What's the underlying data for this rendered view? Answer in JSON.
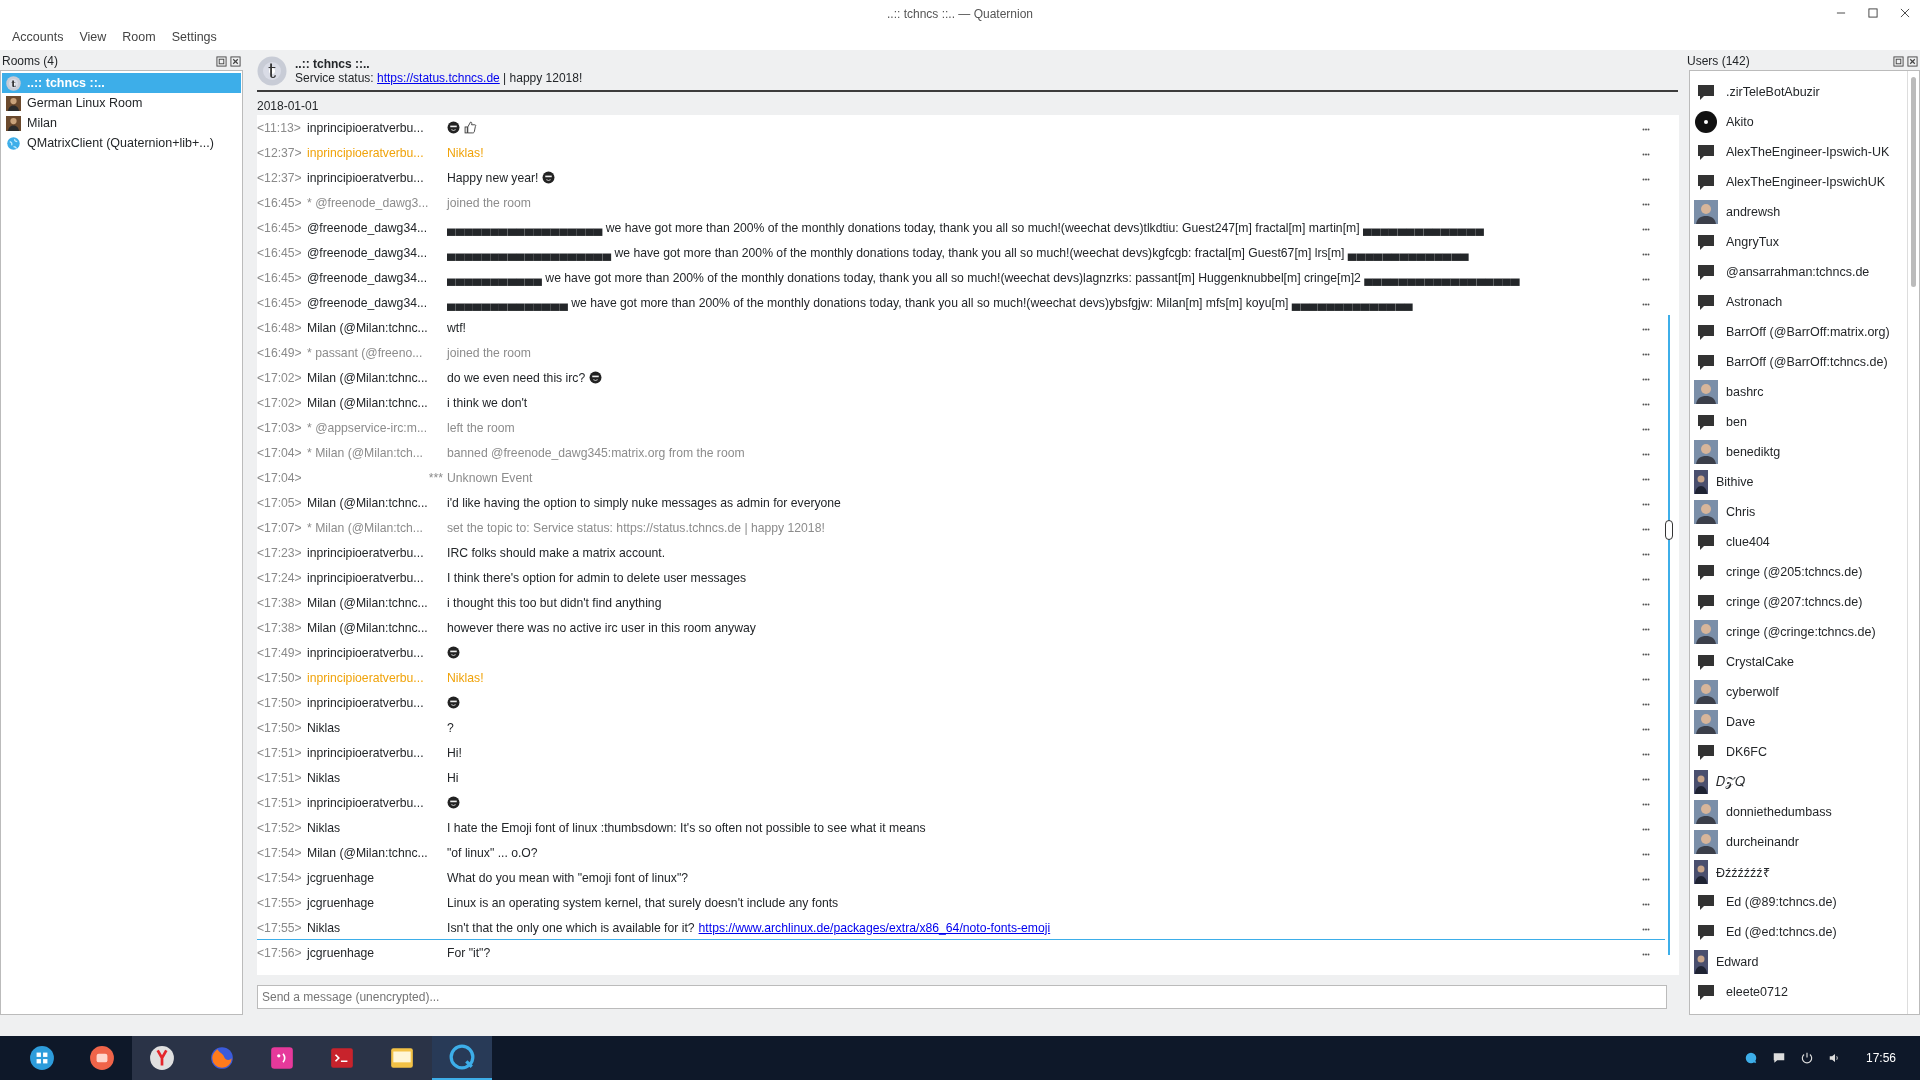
{
  "window": {
    "title": "..:: tchncs ::.. — Quaternion"
  },
  "menu": [
    "Accounts",
    "View",
    "Room",
    "Settings"
  ],
  "rooms": {
    "title": "Rooms (4)",
    "items": [
      {
        "name": "..:: tchncs ::..",
        "kind": "letter",
        "letter": "t",
        "selected": true
      },
      {
        "name": "German Linux Room",
        "kind": "picture",
        "selected": false
      },
      {
        "name": "Milan",
        "kind": "picture",
        "selected": false
      },
      {
        "name": "QMatrixClient (Quaternion+lib+...)",
        "kind": "globe",
        "selected": false
      }
    ]
  },
  "room_header": {
    "name": "..:: tchncs ::..",
    "letter": "t",
    "topic_prefix": "Service status: ",
    "topic_link": "https://status.tchncs.de",
    "topic_suffix": " | happy 12018!"
  },
  "date": "2018-01-01",
  "messages": [
    {
      "time": "<11:13>",
      "author": "inprincipioeratverbu...",
      "kind": "normal",
      "emoji": [
        {
          "kind": "face"
        },
        {
          "kind": "thumb"
        }
      ]
    },
    {
      "time": "<12:37>",
      "author": "inprincipioeratverbu...",
      "text": "Niklas!",
      "kind": "highlight"
    },
    {
      "time": "<12:37>",
      "author": "inprincipioeratverbu...",
      "text": "Happy new year!",
      "kind": "normal",
      "emoji": [
        {
          "kind": "face"
        }
      ]
    },
    {
      "time": "<16:45>",
      "author": "* @freenode_dawg3...",
      "text": "joined the room",
      "kind": "event"
    },
    {
      "time": "<16:45>",
      "author": "@freenode_dawg34...",
      "text": "▄▄▄▄▄▄▄▄▄▄▄▄▄▄▄▄▄▄ we have got more than 200% of the monthly donations today, thank you all so much!(weechat devs)tlkdtiu: Guest247[m] fractal[m] martin[m] ▄▄▄▄▄▄▄▄▄▄▄▄▄▄",
      "kind": "normal"
    },
    {
      "time": "<16:45>",
      "author": "@freenode_dawg34...",
      "text": "▄▄▄▄▄▄▄▄▄▄▄▄▄▄▄▄▄▄▄ we have got more than 200% of the monthly donations today, thank you all so much!(weechat devs)kgfcgb: fractal[m] Guest67[m] lrs[m] ▄▄▄▄▄▄▄▄▄▄▄▄▄▄",
      "kind": "normal"
    },
    {
      "time": "<16:45>",
      "author": "@freenode_dawg34...",
      "text": "▄▄▄▄▄▄▄▄▄▄▄ we have got more than 200% of the monthly donations today, thank you all so much!(weechat devs)lagnzrks: passant[m] Huggenknubbel[m] cringe[m]2 ▄▄▄▄▄▄▄▄▄▄▄▄▄▄▄▄▄▄",
      "kind": "normal"
    },
    {
      "time": "<16:45>",
      "author": "@freenode_dawg34...",
      "text": "▄▄▄▄▄▄▄▄▄▄▄▄▄▄ we have got more than 200% of the monthly donations today, thank you all so much!(weechat devs)ybsfgjw: Milan[m] mfs[m] koyu[m] ▄▄▄▄▄▄▄▄▄▄▄▄▄▄",
      "kind": "normal"
    },
    {
      "time": "<16:48>",
      "author": "Milan (@Milan:tchnc...",
      "text": "wtf!",
      "kind": "normal"
    },
    {
      "time": "<16:49>",
      "author": "* passant (@freeno...",
      "text": "joined the room",
      "kind": "event"
    },
    {
      "time": "<17:02>",
      "author": "Milan (@Milan:tchnc...",
      "text": "do we even need this irc?",
      "kind": "normal",
      "emoji": [
        {
          "kind": "face"
        }
      ]
    },
    {
      "time": "<17:02>",
      "author": "Milan (@Milan:tchnc...",
      "text": "i think we don't",
      "kind": "normal"
    },
    {
      "time": "<17:03>",
      "author": "* @appservice-irc:m...",
      "text": "left the room",
      "kind": "event"
    },
    {
      "time": "<17:04>",
      "author": "* Milan (@Milan:tch...",
      "text": "banned @freenode_dawg345:matrix.org from the room",
      "kind": "event"
    },
    {
      "time": "<17:04>",
      "author": "***",
      "text": "Unknown Event",
      "kind": "unknown"
    },
    {
      "time": "<17:05>",
      "author": "Milan (@Milan:tchnc...",
      "text": "i'd like having the option to simply nuke messages as admin for everyone",
      "kind": "normal"
    },
    {
      "time": "<17:07>",
      "author": "* Milan (@Milan:tch...",
      "text": "set the topic to: Service status: https://status.tchncs.de | happy 12018!",
      "kind": "event"
    },
    {
      "time": "<17:23>",
      "author": "inprincipioeratverbu...",
      "text": "IRC folks should make a matrix account.",
      "kind": "normal"
    },
    {
      "time": "<17:24>",
      "author": "inprincipioeratverbu...",
      "text": "I think there's option for admin to delete user messages",
      "kind": "normal"
    },
    {
      "time": "<17:38>",
      "author": "Milan (@Milan:tchnc...",
      "text": "i thought this too but didn't find anything",
      "kind": "normal"
    },
    {
      "time": "<17:38>",
      "author": "Milan (@Milan:tchnc...",
      "text": "however there was no active irc user in this room anyway",
      "kind": "normal"
    },
    {
      "time": "<17:49>",
      "author": "inprincipioeratverbu...",
      "kind": "normal",
      "emoji": [
        {
          "kind": "face"
        }
      ]
    },
    {
      "time": "<17:50>",
      "author": "inprincipioeratverbu...",
      "text": "Niklas!",
      "kind": "highlight"
    },
    {
      "time": "<17:50>",
      "author": "inprincipioeratverbu...",
      "kind": "normal",
      "emoji": [
        {
          "kind": "face"
        }
      ]
    },
    {
      "time": "<17:50>",
      "author": "Niklas",
      "text": "?",
      "kind": "normal"
    },
    {
      "time": "<17:51>",
      "author": "inprincipioeratverbu...",
      "text": "Hi!",
      "kind": "normal"
    },
    {
      "time": "<17:51>",
      "author": "Niklas",
      "text": "Hi",
      "kind": "normal"
    },
    {
      "time": "<17:51>",
      "author": "inprincipioeratverbu...",
      "kind": "normal",
      "emoji": [
        {
          "kind": "face"
        }
      ]
    },
    {
      "time": "<17:52>",
      "author": "Niklas",
      "text": "I hate the Emoji font of linux :thumbsdown: It's so often not possible to see what it means",
      "kind": "normal"
    },
    {
      "time": "<17:54>",
      "author": "Milan (@Milan:tchnc...",
      "text": "\"of linux\" ... o.O?",
      "kind": "normal"
    },
    {
      "time": "<17:54>",
      "author": "jcgruenhage",
      "text": "What do you mean with \"emoji font of linux\"?",
      "kind": "normal"
    },
    {
      "time": "<17:55>",
      "author": "jcgruenhage",
      "text": "Linux is an operating system kernel, that surely doesn't include any fonts",
      "kind": "normal"
    },
    {
      "time": "<17:55>",
      "author": "Niklas",
      "text": "Isn't that the only one which is available for it? ",
      "link": "https://www.archlinux.de/packages/extra/x86_64/noto-fonts-emoji",
      "kind": "normal",
      "read_marker": true
    },
    {
      "time": "<17:56>",
      "author": "jcgruenhage",
      "text": "For \"it\"?",
      "kind": "normal"
    }
  ],
  "composer": {
    "placeholder": "Send a message (unencrypted)..."
  },
  "users": {
    "title": "Users (142)",
    "items": [
      {
        "name": ".zirTeleBotAbuzir",
        "kind": "bubble"
      },
      {
        "name": "Akito",
        "kind": "disc"
      },
      {
        "name": "AlexTheEngineer-Ipswich-UK",
        "kind": "bubble"
      },
      {
        "name": "AlexTheEngineer-IpswichUK",
        "kind": "bubble"
      },
      {
        "name": "andrewsh"
      },
      {
        "name": "AngryTux",
        "kind": "bubble"
      },
      {
        "name": "@ansarrahman:tchncs.de",
        "kind": "bubble"
      },
      {
        "name": "Astronach",
        "kind": "bubble"
      },
      {
        "name": "BarrOff (@BarrOff:matrix.org)",
        "kind": "bubble"
      },
      {
        "name": "BarrOff (@BarrOff:tchncs.de)",
        "kind": "bubble"
      },
      {
        "name": "bashrc"
      },
      {
        "name": "ben",
        "kind": "bubble"
      },
      {
        "name": "benediktg"
      },
      {
        "name": "Bithive",
        "kind": "narrow"
      },
      {
        "name": "Chris"
      },
      {
        "name": "clue404",
        "kind": "bubble"
      },
      {
        "name": "cringe (@205:tchncs.de)",
        "kind": "bubble"
      },
      {
        "name": "cringe (@207:tchncs.de)",
        "kind": "bubble"
      },
      {
        "name": "cringe (@cringe:tchncs.de)"
      },
      {
        "name": "CrystalCake",
        "kind": "bubble"
      },
      {
        "name": "cyberwolf"
      },
      {
        "name": "Dave"
      },
      {
        "name": "DK6FC",
        "kind": "bubble"
      },
      {
        "name": "𝐷𝒵𝑄",
        "kind": "narrow"
      },
      {
        "name": "donniethedumbass"
      },
      {
        "name": "durcheinandr"
      },
      {
        "name": "Đźźźźźź₹",
        "kind": "narrow"
      },
      {
        "name": "Ed (@89:tchncs.de)",
        "kind": "bubble"
      },
      {
        "name": "Ed (@ed:tchncs.de)",
        "kind": "bubble"
      },
      {
        "name": "Edward",
        "kind": "narrow"
      },
      {
        "name": "eleete0712",
        "kind": "bubble"
      }
    ]
  },
  "taskbar": {
    "apps": [
      {
        "kind": "launcher",
        "active": false
      },
      {
        "kind": "record",
        "active": false
      },
      {
        "kind": "browser-y",
        "active": false
      },
      {
        "kind": "browser-fox",
        "active": false
      },
      {
        "kind": "chat",
        "active": false
      },
      {
        "kind": "terminal",
        "active": false
      },
      {
        "kind": "files",
        "active": false
      },
      {
        "kind": "client",
        "active": true
      }
    ],
    "clock": "17:56"
  }
}
